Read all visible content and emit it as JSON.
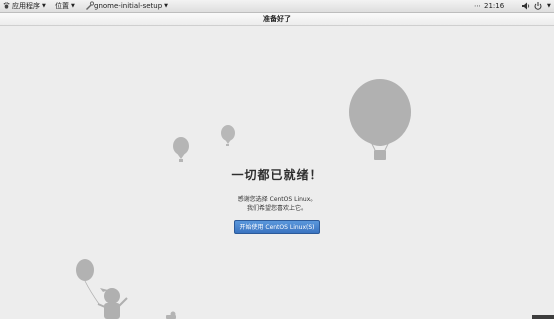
{
  "topbar": {
    "applications_label": "应用程序",
    "places_label": "位置",
    "app_label": "gnome-initial-setup",
    "clock": "21:16"
  },
  "window": {
    "title": "准备好了"
  },
  "main": {
    "heading": "一切都已就绪！",
    "message_line1": "感谢您选择 CentOS Linux。",
    "message_line2": "我们希望您喜欢上它。",
    "start_button_label": "开始使用 CentOS Linux(S)"
  },
  "icons": {
    "footprint": "gnome-foot-icon",
    "app": "gnome-initial-setup-icon",
    "volume": "volume-icon",
    "power": "power-icon"
  },
  "colors": {
    "accent": "#3a73c0",
    "background": "#ededed",
    "illustration": "#b3b3b3"
  }
}
